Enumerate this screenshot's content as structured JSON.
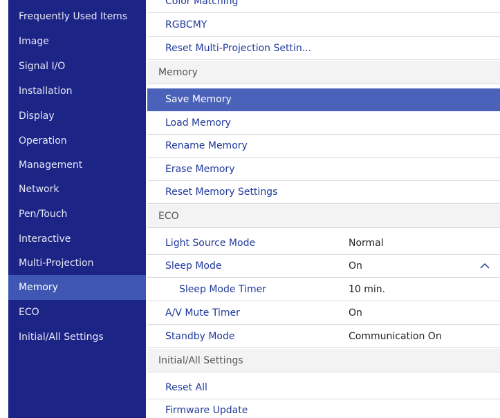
{
  "sidebar": {
    "items": [
      {
        "label": "Frequently Used Items"
      },
      {
        "label": "Image"
      },
      {
        "label": "Signal I/O"
      },
      {
        "label": "Installation"
      },
      {
        "label": "Display"
      },
      {
        "label": "Operation"
      },
      {
        "label": "Management"
      },
      {
        "label": "Network"
      },
      {
        "label": "Pen/Touch"
      },
      {
        "label": "Interactive"
      },
      {
        "label": "Multi-Projection"
      },
      {
        "label": "Memory",
        "active": true
      },
      {
        "label": "ECO"
      },
      {
        "label": "Initial/All Settings"
      }
    ]
  },
  "main": {
    "cut_top_label": "Color Matching",
    "multi": {
      "rgbcmy": "RGBCMY",
      "reset": "Reset Multi-Projection Settin..."
    },
    "memory": {
      "header": "Memory",
      "save": "Save Memory",
      "load": "Load Memory",
      "rename": "Rename Memory",
      "erase": "Erase Memory",
      "reset": "Reset Memory Settings"
    },
    "eco": {
      "header": "ECO",
      "light_source_mode": {
        "label": "Light Source Mode",
        "value": "Normal"
      },
      "sleep_mode": {
        "label": "Sleep Mode",
        "value": "On"
      },
      "sleep_mode_timer": {
        "label": "Sleep Mode Timer",
        "value": "10 min."
      },
      "av_mute_timer": {
        "label": "A/V Mute Timer",
        "value": "On"
      },
      "standby_mode": {
        "label": "Standby Mode",
        "value": "Communication On"
      }
    },
    "initial": {
      "header": "Initial/All Settings",
      "reset_all": "Reset All",
      "firmware_update": "Firmware Update"
    }
  },
  "colors": {
    "sidebar_bg": "#1c2486",
    "sidebar_active": "#3f57b3",
    "selected_row": "#4a62b9",
    "item_text": "#1f3899"
  },
  "icons": {
    "expand": "chevron-up-icon"
  }
}
